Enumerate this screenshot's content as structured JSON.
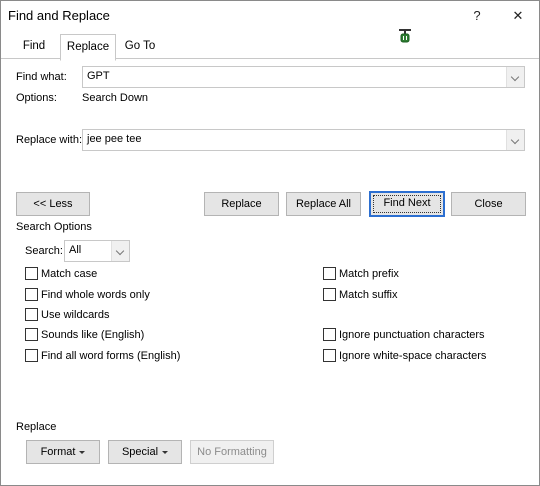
{
  "window": {
    "title": "Find and Replace",
    "help_label": "?",
    "close_label": "✕"
  },
  "tabs": [
    {
      "label": "Find",
      "active": false
    },
    {
      "label": "Replace",
      "active": true
    },
    {
      "label": "Go To",
      "active": false
    }
  ],
  "find": {
    "label": "Find what:",
    "value": "GPT"
  },
  "options": {
    "label": "Options:",
    "value": "Search Down"
  },
  "replace": {
    "label": "Replace with:",
    "value": "jee pee tee"
  },
  "buttons": {
    "less": "<< Less",
    "replace": "Replace",
    "replace_all": "Replace All",
    "find_next": "Find Next",
    "close": "Close"
  },
  "search_options": {
    "heading": "Search Options",
    "search_label": "Search:",
    "search_value": "All",
    "left": [
      {
        "label": "Match case",
        "checked": false
      },
      {
        "label": "Find whole words only",
        "checked": false
      },
      {
        "label": "Use wildcards",
        "checked": false
      },
      {
        "label": "Sounds like (English)",
        "checked": false
      },
      {
        "label": "Find all word forms (English)",
        "checked": false
      }
    ],
    "right": [
      {
        "label": "Match prefix",
        "checked": false
      },
      {
        "label": "Match suffix",
        "checked": false
      },
      {
        "label": "Ignore punctuation characters",
        "checked": false
      },
      {
        "label": "Ignore white-space characters",
        "checked": false
      }
    ]
  },
  "replace_section": {
    "heading": "Replace",
    "format": "Format",
    "special": "Special",
    "no_formatting": "No Formatting"
  }
}
